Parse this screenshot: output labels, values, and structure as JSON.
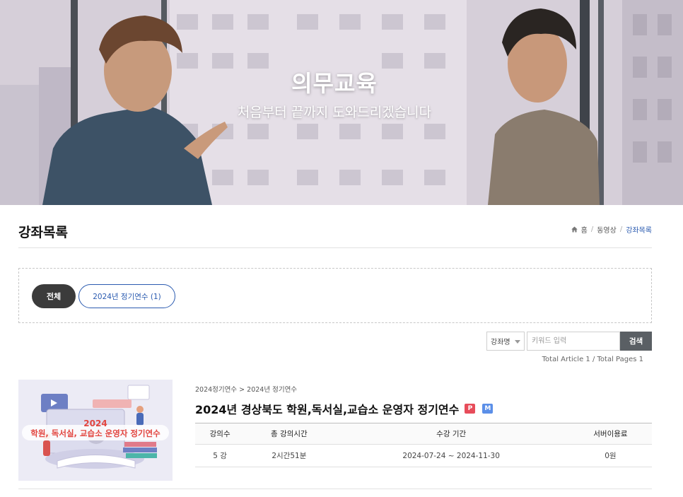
{
  "hero": {
    "title": "의무교육",
    "subtitle": "처음부터 끝까지 도와드리겠습니다"
  },
  "page": {
    "title": "강좌목록"
  },
  "breadcrumb": {
    "icon": "home-icon",
    "items": [
      "홈",
      "동영상",
      "강좌목록"
    ]
  },
  "filters": {
    "all_label": "전체",
    "category_label": "2024년 정기연수 (1)"
  },
  "search": {
    "select_value": "강좌명",
    "placeholder": "키워드 입력",
    "button_label": "검색"
  },
  "totals": {
    "text": "Total Article 1 / Total Pages 1"
  },
  "course": {
    "category_path": [
      "2024정기연수",
      "2024년 정기연수"
    ],
    "path_separator": ">",
    "title": "2024년 경상북도 학원,독서실,교습소 운영자 정기연수",
    "badges": [
      "P",
      "M"
    ],
    "thumbnail": {
      "year": "2024",
      "caption": "학원, 독서실, 교습소 운영자 정기연수"
    },
    "table": {
      "headers": [
        "강의수",
        "총 강의시간",
        "수강 기간",
        "서버이용료"
      ],
      "row": [
        "5 강",
        "2시간51분",
        "2024-07-24 ~ 2024-11-30",
        "0원"
      ]
    }
  },
  "colors": {
    "accent": "#2b5bb0",
    "dark_chip": "#3b3b3b",
    "search_button": "#5a5f64",
    "badge_p": "#e74c5a",
    "badge_m": "#5b8fe8"
  }
}
